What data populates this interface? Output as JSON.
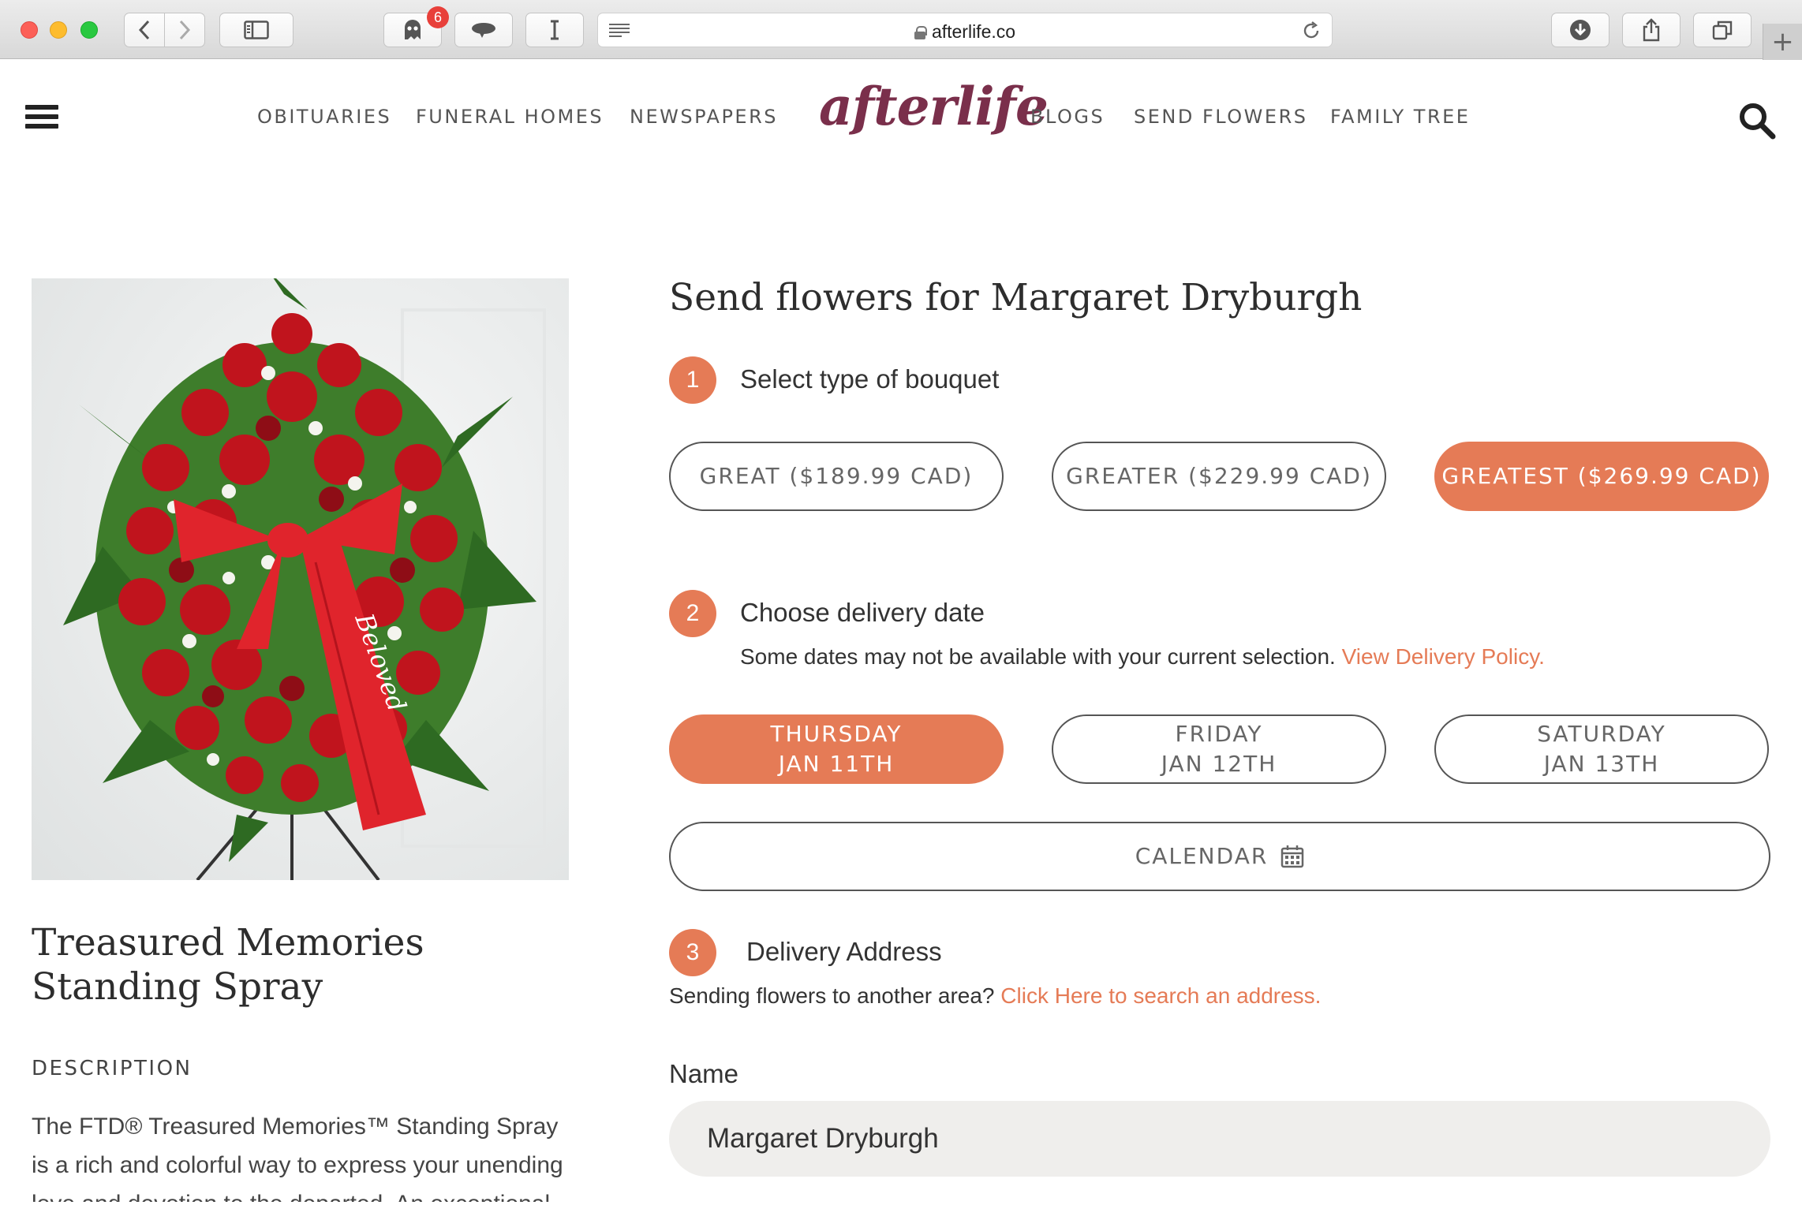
{
  "browser": {
    "url": "afterlife.co",
    "extension_badge": "6"
  },
  "header": {
    "logo": "afterlife",
    "nav_left": [
      "OBITUARIES",
      "FUNERAL HOMES",
      "NEWSPAPERS"
    ],
    "nav_right": [
      "BLOGS",
      "SEND FLOWERS",
      "FAMILY TREE"
    ]
  },
  "product": {
    "ribbon_text": "Beloved",
    "title": "Treasured Memories Standing Spray",
    "description_heading": "DESCRIPTION",
    "description": "The FTD® Treasured Memories™ Standing Spray is a rich and colorful way to express your unending love and devotion to the departed. An exceptional"
  },
  "order": {
    "title": "Send flowers for Margaret Dryburgh",
    "step1": {
      "number": "1",
      "label": "Select type of bouquet"
    },
    "bouquets": [
      {
        "label": "GREAT ($189.99 CAD)",
        "selected": false
      },
      {
        "label": "GREATER ($229.99 CAD)",
        "selected": false
      },
      {
        "label": "GREATEST ($269.99 CAD)",
        "selected": true
      }
    ],
    "step2": {
      "number": "2",
      "label": "Choose delivery date",
      "note": "Some dates may not be available with your current selection.",
      "link": "View Delivery Policy."
    },
    "dates": [
      {
        "day": "THURSDAY",
        "date": "JAN 11TH",
        "selected": true
      },
      {
        "day": "FRIDAY",
        "date": "JAN 12TH",
        "selected": false
      },
      {
        "day": "SATURDAY",
        "date": "JAN 13TH",
        "selected": false
      }
    ],
    "calendar_label": "CALENDAR",
    "step3": {
      "number": "3",
      "label": "Delivery Address",
      "note": "Sending flowers to another area?",
      "link": "Click Here to search an address."
    },
    "name_label": "Name",
    "name_value": "Margaret Dryburgh"
  },
  "colors": {
    "accent": "#e57b56",
    "logo": "#7a2f4b",
    "input_bg": "#efeeec"
  }
}
